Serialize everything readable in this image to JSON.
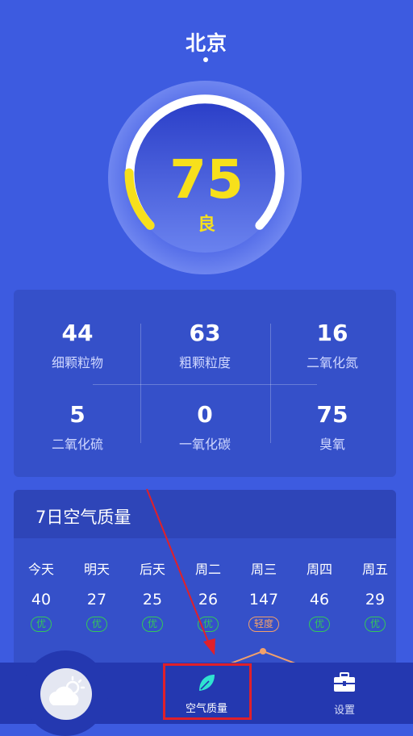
{
  "city": "北京",
  "aqi": {
    "value": "75",
    "level": "良",
    "gauge_fraction": 0.15
  },
  "pollutants": [
    {
      "value": "44",
      "label": "细颗粒物"
    },
    {
      "value": "63",
      "label": "粗颗粒度"
    },
    {
      "value": "16",
      "label": "二氧化氮"
    },
    {
      "value": "5",
      "label": "二氧化硫"
    },
    {
      "value": "0",
      "label": "一氧化碳"
    },
    {
      "value": "75",
      "label": "臭氧"
    }
  ],
  "forecast": {
    "title": "7日空气质量",
    "days": [
      {
        "name": "今天",
        "aqi": "40",
        "level": "优"
      },
      {
        "name": "明天",
        "aqi": "27",
        "level": "优"
      },
      {
        "name": "后天",
        "aqi": "25",
        "level": "优"
      },
      {
        "name": "周二",
        "aqi": "26",
        "level": "优"
      },
      {
        "name": "周三",
        "aqi": "147",
        "level": "轻度"
      },
      {
        "name": "周四",
        "aqi": "46",
        "level": "优"
      },
      {
        "name": "周五",
        "aqi": "29",
        "level": "优"
      }
    ]
  },
  "nav": {
    "weather_icon": "cloud-sun-icon",
    "air_label": "空气质量",
    "settings_label": "设置"
  },
  "colors": {
    "background": "#3d5be0",
    "accent_yellow": "#f7e01b",
    "good_green": "#34c759",
    "light_orange": "#f2a06b",
    "highlight_red": "#e0202a"
  }
}
